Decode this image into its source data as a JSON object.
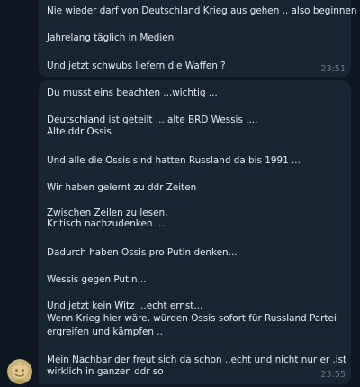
{
  "messages": [
    {
      "lines": [
        "Nie wieder darf von Deutschland Krieg aus gehen .. also beginnen ...",
        "",
        "Jahrelang täglich in Medien",
        "",
        "Und jetzt schwubs liefern die Waffen ?"
      ],
      "time": "23:51"
    },
    {
      "lines": [
        "Du musst eins beachten ...wichtig ...",
        "",
        "Deutschland ist geteilt ....alte BRD Wessis ....",
        "Alte ddr Ossis",
        "",
        "Und alle die Ossis sind hatten Russland da bis 1991 ...",
        "",
        "Wir haben gelernt zu ddr Zeiten",
        "",
        "Zwischen Zeilen zu lesen,",
        "Kritisch nachzudenken ...",
        "",
        "Dadurch haben Ossis pro Putin denken...",
        "",
        "Wessis gegen Putin...",
        "",
        "Und jetzt kein Witz ...echt ernst...",
        "Wenn Krieg hier wäre, würden Ossis sofort für Russland Partei",
        "ergreifen und kämpfen ..",
        "",
        "Mein Nachbar der freut sich da schon ..echt und nicht nur er .ist",
        "wirklich in ganzen ddr so"
      ],
      "time": "23:55"
    }
  ],
  "avatar": {
    "icon": "user-avatar-icon",
    "colors": {
      "background": "#c9b27a",
      "face": "#e6c98f",
      "dark": "#7a6334"
    }
  },
  "colors": {
    "background": "#0e1621",
    "bubble": "#182533",
    "text": "#e8eef3",
    "time": "#6d7f8f"
  }
}
